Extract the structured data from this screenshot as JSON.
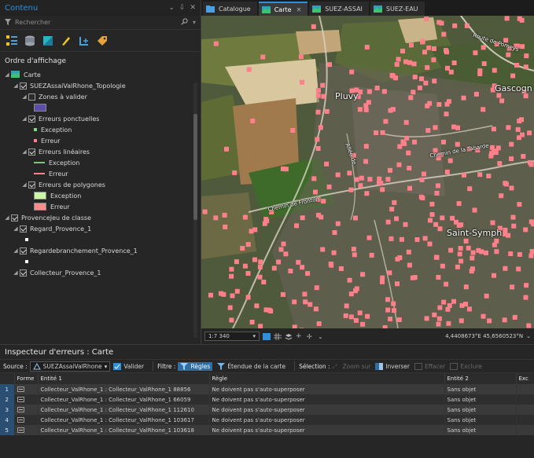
{
  "contents": {
    "title": "Contenu",
    "window_controls": [
      "⌄",
      "⇩",
      "✕"
    ],
    "search_placeholder": "Rechercher",
    "search_icon": "search-icon",
    "display_order_heading": "Ordre d'affichage",
    "tree": [
      {
        "label": "Carte",
        "level": 0,
        "expand": "◢",
        "checkbox": false,
        "icon": "map-icon"
      },
      {
        "label": "SUEZAssaiValRhone_Topologie",
        "level": 1,
        "expand": "◢",
        "checkbox": true,
        "checked": true
      },
      {
        "label": "Zones à valider",
        "level": 2,
        "expand": "◢",
        "checkbox": true,
        "checked": false
      },
      {
        "swatch": "fill",
        "color": "#5c4fa8",
        "level": 3
      },
      {
        "label": "Erreurs ponctuelles",
        "level": 2,
        "expand": "◢",
        "checkbox": true,
        "checked": true
      },
      {
        "label": "Exception",
        "level": 3,
        "swatch": "dot",
        "color": "#7be07b"
      },
      {
        "label": "Erreur",
        "level": 3,
        "swatch": "dot",
        "color": "#ff7f8a"
      },
      {
        "label": "Erreurs linéaires",
        "level": 2,
        "expand": "◢",
        "checkbox": true,
        "checked": true
      },
      {
        "label": "Exception",
        "level": 3,
        "swatch": "line",
        "color": "#6bd36b"
      },
      {
        "label": "Erreur",
        "level": 3,
        "swatch": "line",
        "color": "#ff7f8a"
      },
      {
        "label": "Erreurs de polygones",
        "level": 2,
        "expand": "◢",
        "checkbox": true,
        "checked": true
      },
      {
        "label": "Exception",
        "level": 3,
        "swatch": "fill",
        "color": "#c9f7a3"
      },
      {
        "label": "Erreur",
        "level": 3,
        "swatch": "fill",
        "color": "#ff8c8c"
      },
      {
        "label": "ProvenceJeu de classe",
        "level": 0,
        "expand": "◢",
        "checkbox": true,
        "checked": true
      },
      {
        "label": "Regard_Provence_1",
        "level": 1,
        "expand": "◢",
        "checkbox": true,
        "checked": true
      },
      {
        "swatch": "dot",
        "color": "#ffffff",
        "level": 2
      },
      {
        "label": "Regardebranchement_Provence_1",
        "level": 1,
        "expand": "◢",
        "checkbox": true,
        "checked": true
      },
      {
        "swatch": "dot",
        "color": "#ffffff",
        "level": 2
      },
      {
        "label": "Collecteur_Provence_1",
        "level": 1,
        "expand": "◢",
        "checkbox": true,
        "checked": true
      }
    ]
  },
  "mapview": {
    "tabs": [
      {
        "label": "Catalogue",
        "active": false,
        "closable": false
      },
      {
        "label": "Carte",
        "active": true,
        "closable": true
      },
      {
        "label": "SUEZ-ASSAI",
        "active": false,
        "closable": false
      },
      {
        "label": "SUEZ-EAU",
        "active": false,
        "closable": false
      }
    ],
    "labels": {
      "pluvy": "Pluvy",
      "gascogne": "Gascogn",
      "saint_symph": "Saint-Symph",
      "route_pomeys": "Route de Pomeys",
      "chemin_tabarde": "Chemin de la Tabarde",
      "chemin_fronton": "Chemin de Fronton",
      "allee": "Allée de"
    },
    "scale": "1:7 340",
    "coordinates": "4,4408673°E 45,6560523°N",
    "accent": "#2f8fd8"
  },
  "inspector": {
    "title": "Inspecteur d'erreurs : Carte",
    "source_label": "Source :",
    "source_value": "SUEZAssaiValRhone",
    "validate": "Valider",
    "filter_label": "Filtre :",
    "rules": "Règles",
    "map_extent": "Étendue de la carte",
    "selection_label": "Sélection :",
    "select_by": "Zoom sur",
    "invert": "Inverser",
    "clear": "Effacer",
    "delete": "Exclure",
    "columns": [
      "",
      "Forme",
      "Entité 1",
      "Règle",
      "Entité 2",
      "Exc"
    ],
    "rows": [
      {
        "n": "1",
        "entity1": "Collecteur_ValRhone_1 : Collecteur_ValRhone_1 88856",
        "rule": "Ne doivent pas s'auto-superposer",
        "entity2": "Sans objet"
      },
      {
        "n": "2",
        "entity1": "Collecteur_ValRhone_1 : Collecteur_ValRhone_1 66059",
        "rule": "Ne doivent pas s'auto-superposer",
        "entity2": "Sans objet"
      },
      {
        "n": "3",
        "entity1": "Collecteur_ValRhone_1 : Collecteur_ValRhone_1 112610",
        "rule": "Ne doivent pas s'auto-superposer",
        "entity2": "Sans objet"
      },
      {
        "n": "4",
        "entity1": "Collecteur_ValRhone_1 : Collecteur_ValRhone_1 103617",
        "rule": "Ne doivent pas s'auto-superposer",
        "entity2": "Sans objet"
      },
      {
        "n": "5",
        "entity1": "Collecteur_ValRhone_1 : Collecteur_ValRhone_1 103618",
        "rule": "Ne doivent pas s'auto-superposer",
        "entity2": "Sans objet"
      }
    ]
  }
}
